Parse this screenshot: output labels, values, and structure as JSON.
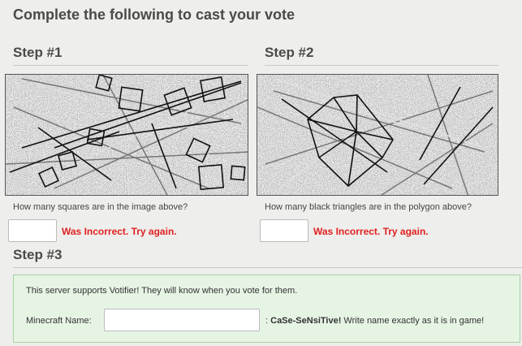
{
  "page": {
    "title": "Complete the following to cast your vote"
  },
  "step1": {
    "title": "Step #1",
    "question": "How many squares are in the image above?",
    "answer_value": "",
    "error": "Was Incorrect. Try again."
  },
  "step2": {
    "title": "Step #2",
    "question": "How many black triangles are in the polygon above?",
    "answer_value": "",
    "error": "Was Incorrect. Try again."
  },
  "step3": {
    "title": "Step #3",
    "votifier_text": "This server supports Votifier! They will know when you vote for them.",
    "mc_label": "Minecraft Name:",
    "mc_value": "",
    "case_prefix": ":",
    "case_word": "CaSe-SeNsiTive!",
    "case_rest": "Write name exactly as it is in game!"
  },
  "colors": {
    "error": "#e02020",
    "votifier_bg": "#e6f4e4",
    "votifier_border": "#a6d3a1"
  }
}
